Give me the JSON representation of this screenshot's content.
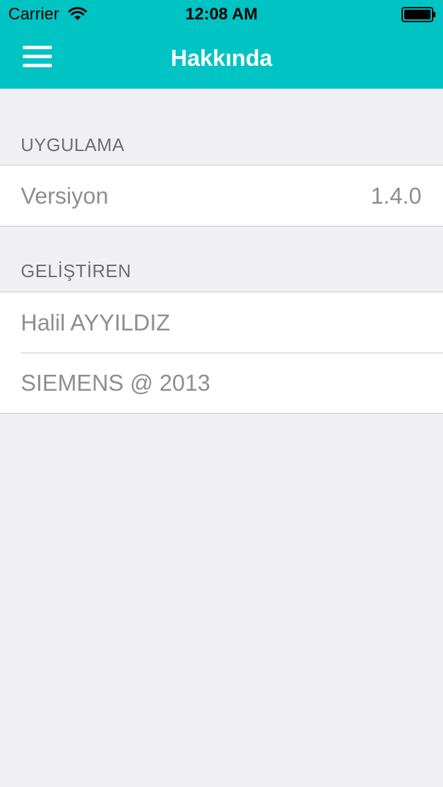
{
  "status_bar": {
    "carrier": "Carrier",
    "time": "12:08 AM",
    "wifi_icon": "wifi-icon",
    "battery_icon": "battery-icon"
  },
  "nav": {
    "menu_icon": "hamburger-menu-icon",
    "title": "Hakkında",
    "background_color": "#00c4c4"
  },
  "sections": [
    {
      "header": "UYGULAMA",
      "rows": [
        {
          "label": "Versiyon",
          "value": "1.4.0"
        }
      ]
    },
    {
      "header": "GELİŞTİREN",
      "rows": [
        {
          "label": "Halil AYYILDIZ"
        },
        {
          "label": "SIEMENS @ 2013"
        }
      ]
    }
  ]
}
